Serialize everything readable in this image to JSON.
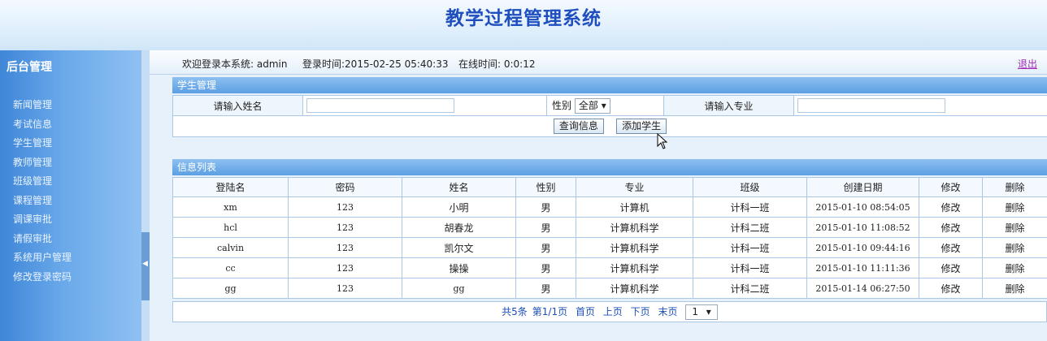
{
  "header": {
    "title": "教学过程管理系统"
  },
  "sidebar": {
    "title": "后台管理",
    "items": [
      "新闻管理",
      "考试信息",
      "学生管理",
      "教师管理",
      "班级管理",
      "课程管理",
      "调课审批",
      "请假审批",
      "系统用户管理",
      "修改登录密码"
    ]
  },
  "topbar": {
    "welcome": "欢迎登录本系统: admin",
    "login_time": "登录时间:2015-02-25 05:40:33",
    "online_time": "在线时间: 0:0:12",
    "logout": "退出"
  },
  "search": {
    "panel_title": "学生管理",
    "name_label": "请输入姓名",
    "name_value": "",
    "gender_label": "性别",
    "gender_selected": "全部",
    "major_label": "请输入专业",
    "major_value": "",
    "query_button": "查询信息",
    "add_button": "添加学生"
  },
  "list": {
    "panel_title": "信息列表",
    "columns": [
      "登陆名",
      "密码",
      "姓名",
      "性别",
      "专业",
      "班级",
      "创建日期",
      "修改",
      "删除"
    ],
    "rows": [
      [
        "xm",
        "123",
        "小明",
        "男",
        "计算机",
        "计科一班",
        "2015-01-10 08:54:05",
        "修改",
        "删除"
      ],
      [
        "hcl",
        "123",
        "胡春龙",
        "男",
        "计算机科学",
        "计科二班",
        "2015-01-10 11:08:52",
        "修改",
        "删除"
      ],
      [
        "calvin",
        "123",
        "凯尔文",
        "男",
        "计算机科学",
        "计科一班",
        "2015-01-10 09:44:16",
        "修改",
        "删除"
      ],
      [
        "cc",
        "123",
        "操操",
        "男",
        "计算机科学",
        "计科一班",
        "2015-01-10 11:11:36",
        "修改",
        "删除"
      ],
      [
        "gg",
        "123",
        "gg",
        "男",
        "计算机科学",
        "计科二班",
        "2015-01-14 06:27:50",
        "修改",
        "删除"
      ]
    ]
  },
  "pager": {
    "total": "共5条",
    "page_info": "第1/1页",
    "first": "首页",
    "prev": "上页",
    "next": "下页",
    "last": "末页",
    "page_selected": "1"
  }
}
